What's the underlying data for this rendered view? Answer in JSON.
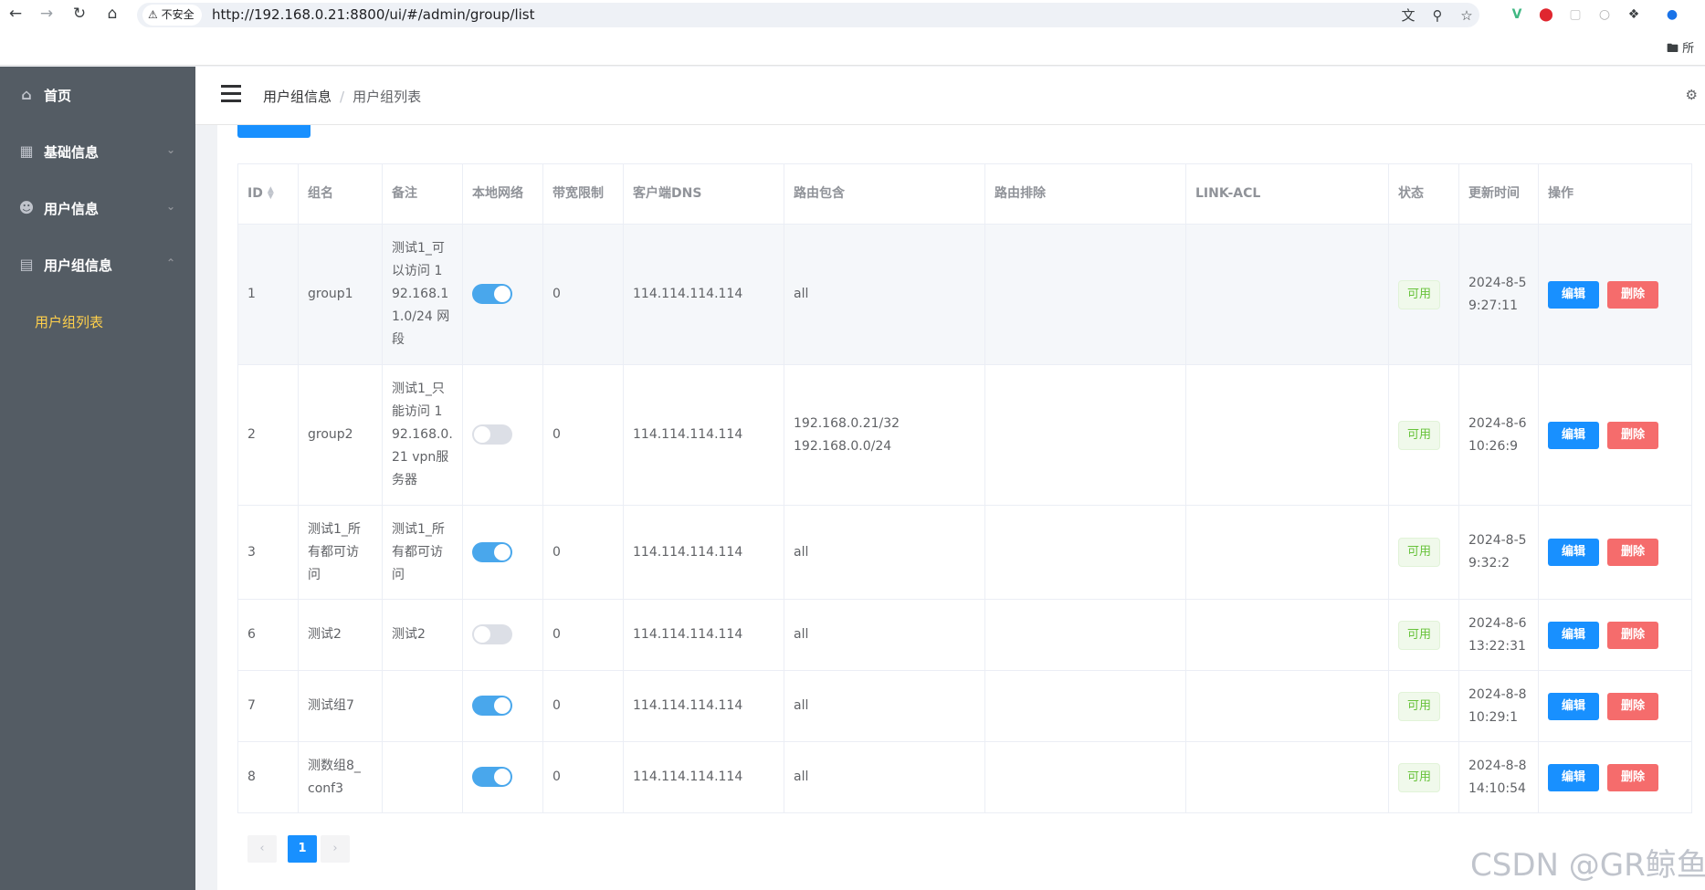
{
  "browser": {
    "security_label": "不安全",
    "url": "http://192.168.0.21:8800/ui/#/admin/group/list",
    "bookmarks_label": "所"
  },
  "sidebar": {
    "items": [
      {
        "label": "首页",
        "icon": "home-icon"
      },
      {
        "label": "基础信息",
        "icon": "grid-icon"
      },
      {
        "label": "用户信息",
        "icon": "user-icon"
      },
      {
        "label": "用户组信息",
        "icon": "clipboard-icon"
      }
    ],
    "subitems": [
      {
        "label": "用户组列表",
        "active_color": "#ffd04b"
      }
    ]
  },
  "header": {
    "breadcrumb": [
      "用户组信息",
      "用户组列表"
    ]
  },
  "table": {
    "columns": [
      "ID",
      "组名",
      "备注",
      "本地网络",
      "带宽限制",
      "客户端DNS",
      "路由包含",
      "路由排除",
      "LINK-ACL",
      "状态",
      "更新时间",
      "操作"
    ],
    "rows": [
      {
        "id": "1",
        "name": "group1",
        "remark": [
          "测试1_可",
          "以访问 1",
          "92.168.1",
          "1.0/24 网",
          "段"
        ],
        "local_net": true,
        "bandwidth": "0",
        "dns": "114.114.114.114",
        "route_include": [
          "all"
        ],
        "route_exclude": "",
        "link_acl": "",
        "status": "可用",
        "updated": [
          "2024-8-5",
          "9:27:11"
        ],
        "edit": "编辑",
        "delete": "删除"
      },
      {
        "id": "2",
        "name": "group2",
        "remark": [
          "测试1_只",
          "能访问 1",
          "92.168.0.",
          "21 vpn服",
          "务器"
        ],
        "local_net": false,
        "bandwidth": "0",
        "dns": "114.114.114.114",
        "route_include": [
          "192.168.0.21/32",
          "192.168.0.0/24"
        ],
        "route_exclude": "",
        "link_acl": "",
        "status": "可用",
        "updated": [
          "2024-8-6",
          "10:26:9"
        ],
        "edit": "编辑",
        "delete": "删除"
      },
      {
        "id": "3",
        "name": "测试1_所有都可访问",
        "name_lines": [
          "测试1_所",
          "有都可访",
          "问"
        ],
        "remark": [
          "测试1_所",
          "有都可访",
          "问"
        ],
        "local_net": true,
        "bandwidth": "0",
        "dns": "114.114.114.114",
        "route_include": [
          "all"
        ],
        "route_exclude": "",
        "link_acl": "",
        "status": "可用",
        "updated": [
          "2024-8-5",
          "9:32:2"
        ],
        "edit": "编辑",
        "delete": "删除"
      },
      {
        "id": "6",
        "name": "测试2",
        "remark": [
          "测试2"
        ],
        "local_net": false,
        "bandwidth": "0",
        "dns": "114.114.114.114",
        "route_include": [
          "all"
        ],
        "route_exclude": "",
        "link_acl": "",
        "status": "可用",
        "updated": [
          "2024-8-6",
          "13:22:31"
        ],
        "edit": "编辑",
        "delete": "删除"
      },
      {
        "id": "7",
        "name": "测试组7",
        "remark": [],
        "local_net": true,
        "bandwidth": "0",
        "dns": "114.114.114.114",
        "route_include": [
          "all"
        ],
        "route_exclude": "",
        "link_acl": "",
        "status": "可用",
        "updated": [
          "2024-8-8",
          "10:29:1"
        ],
        "edit": "编辑",
        "delete": "删除"
      },
      {
        "id": "8",
        "name": "测数组8_conf3",
        "name_lines": [
          "测数组8_",
          "conf3"
        ],
        "remark": [],
        "local_net": true,
        "bandwidth": "0",
        "dns": "114.114.114.114",
        "route_include": [
          "all"
        ],
        "route_exclude": "",
        "link_acl": "",
        "status": "可用",
        "updated": [
          "2024-8-8",
          "14:10:54"
        ],
        "edit": "编辑",
        "delete": "删除"
      }
    ]
  },
  "pagination": {
    "prev": "‹",
    "current": "1",
    "next": "›"
  },
  "watermark": "CSDN @GR鲸鱼",
  "colors": {
    "sidebar_bg": "#545c64",
    "primary": "#1890ff",
    "danger": "#f56c6c",
    "success": "#67c23a",
    "switch_on": "#49a7ec"
  }
}
